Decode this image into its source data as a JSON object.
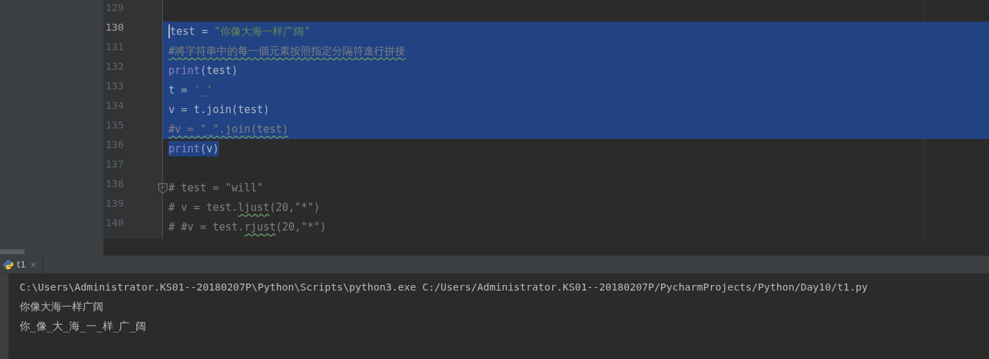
{
  "editor": {
    "lines": [
      {
        "number": "129",
        "current": false,
        "selected": false,
        "fold": false
      },
      {
        "number": "130",
        "current": true,
        "selected": true,
        "fold": false,
        "tokens": [
          {
            "kind": "plain",
            "text": "test = "
          },
          {
            "kind": "string",
            "text": "\"你像大海一样广阔\""
          }
        ]
      },
      {
        "number": "131",
        "current": false,
        "selected": true,
        "fold": false,
        "tokens": [
          {
            "kind": "comment",
            "typo": true,
            "text": "#將字符串中的每一個元素按照指定分隔符進行拼接"
          }
        ]
      },
      {
        "number": "132",
        "current": false,
        "selected": true,
        "fold": false,
        "tokens": [
          {
            "kind": "builtin",
            "text": "print"
          },
          {
            "kind": "plain",
            "text": "(test)"
          }
        ]
      },
      {
        "number": "133",
        "current": false,
        "selected": true,
        "fold": false,
        "tokens": [
          {
            "kind": "plain",
            "text": "t = "
          },
          {
            "kind": "string",
            "text": "'_'"
          }
        ]
      },
      {
        "number": "134",
        "current": false,
        "selected": true,
        "fold": false,
        "tokens": [
          {
            "kind": "plain",
            "text": "v = t.join(test)"
          }
        ]
      },
      {
        "number": "135",
        "current": false,
        "selected": true,
        "fold": false,
        "tokens": [
          {
            "kind": "comment",
            "typo": true,
            "text": "#v = \"_\".join(test)"
          }
        ]
      },
      {
        "number": "136",
        "current": false,
        "selected": true,
        "fold": false,
        "tokens": [
          {
            "kind": "builtin",
            "text": "print"
          },
          {
            "kind": "plain",
            "text": "(v)"
          }
        ]
      },
      {
        "number": "137",
        "current": false,
        "selected": false,
        "fold": false
      },
      {
        "number": "138",
        "current": false,
        "selected": false,
        "fold": true,
        "tokens": [
          {
            "kind": "comment",
            "typo": false,
            "text": "# test = \"will\""
          }
        ]
      },
      {
        "number": "139",
        "current": false,
        "selected": false,
        "fold": false,
        "tokens": [
          {
            "kind": "comment",
            "typo": false,
            "text": "# v = test."
          },
          {
            "kind": "comment",
            "typo": true,
            "text": "ljust"
          },
          {
            "kind": "comment",
            "typo": false,
            "text": "(20,\"*\")"
          }
        ]
      },
      {
        "number": "140",
        "current": false,
        "selected": false,
        "fold": false,
        "tokens": [
          {
            "kind": "comment",
            "typo": false,
            "text": "# #v = test."
          },
          {
            "kind": "comment",
            "typo": true,
            "text": "rjust"
          },
          {
            "kind": "comment",
            "typo": false,
            "text": "(20,\"*\")"
          }
        ]
      }
    ]
  },
  "run_panel": {
    "tabs": [
      {
        "label": "t1",
        "close": "×",
        "selected": true
      }
    ],
    "output": [
      "C:\\Users\\Administrator.KS01--20180207P\\Python\\Scripts\\python3.exe C:/Users/Administrator.KS01--20180207P/PycharmProjects/Python/Day10/t1.py",
      "你像大海一样广阔",
      "你_像_大_海_一_样_广_阔"
    ]
  }
}
